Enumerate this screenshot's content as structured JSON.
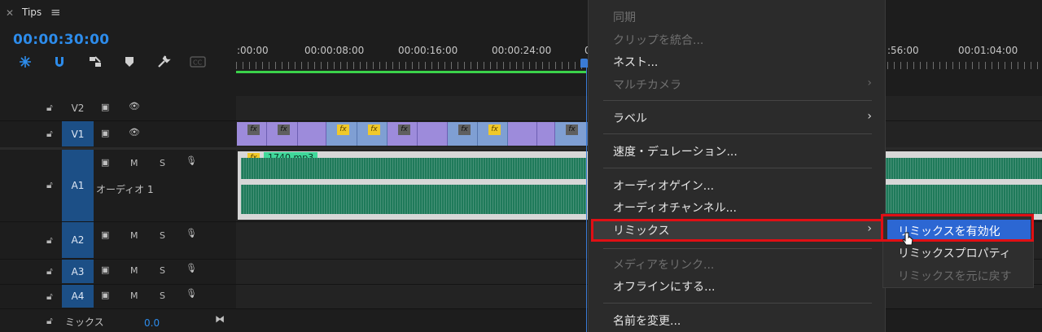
{
  "panel": {
    "tab_title": "Tips",
    "timecode": "00:00:30:00"
  },
  "ruler": {
    "labels": [
      ":00:00",
      "00:00:08:00",
      "00:00:16:00",
      "00:00:24:00",
      "0",
      ":56:00",
      "00:01:04:00"
    ]
  },
  "tracks": {
    "v2": {
      "label": "V2"
    },
    "v1": {
      "label": "V1"
    },
    "a1": {
      "label": "A1",
      "name": "オーディオ 1",
      "m": "M",
      "s": "S"
    },
    "a2": {
      "label": "A2",
      "m": "M",
      "s": "S"
    },
    "a3": {
      "label": "A3",
      "m": "M",
      "s": "S"
    },
    "a4": {
      "label": "A4",
      "m": "M",
      "s": "S"
    },
    "mix": {
      "label": "ミックス",
      "value": "0.0"
    }
  },
  "audio_clip": {
    "fx": "fx",
    "name": "1740.mp3"
  },
  "fx_badge": "fx",
  "context_menu": {
    "items": [
      {
        "label": "同期",
        "enabled": false
      },
      {
        "label": "クリップを統合...",
        "enabled": false
      },
      {
        "label": "ネスト...",
        "enabled": true
      },
      {
        "label": "マルチカメラ",
        "enabled": false,
        "submenu": true
      },
      {
        "label": "ラベル",
        "enabled": true,
        "submenu": true
      },
      {
        "label": "速度・デュレーション...",
        "enabled": true
      },
      {
        "label": "オーディオゲイン...",
        "enabled": true
      },
      {
        "label": "オーディオチャンネル...",
        "enabled": true
      },
      {
        "label": "リミックス",
        "enabled": true,
        "submenu": true,
        "highlighted": true
      },
      {
        "label": "メディアをリンク...",
        "enabled": false
      },
      {
        "label": "オフラインにする...",
        "enabled": true
      },
      {
        "label": "名前を変更...",
        "enabled": true
      }
    ],
    "chevron": "›"
  },
  "remix_submenu": {
    "items": [
      {
        "label": "リミックスを有効化",
        "enabled": true,
        "selected": true
      },
      {
        "label": "リミックスプロパティ",
        "enabled": true
      },
      {
        "label": "リミックスを元に戻す",
        "enabled": false
      }
    ]
  },
  "colors": {
    "accent": "#2d8ceb",
    "highlight_box": "#e00f14",
    "selection": "#2c67d3",
    "audio_clip": "#1f7a5a",
    "video_clip": "#9d8bdb",
    "work_area": "#3bd24a"
  }
}
